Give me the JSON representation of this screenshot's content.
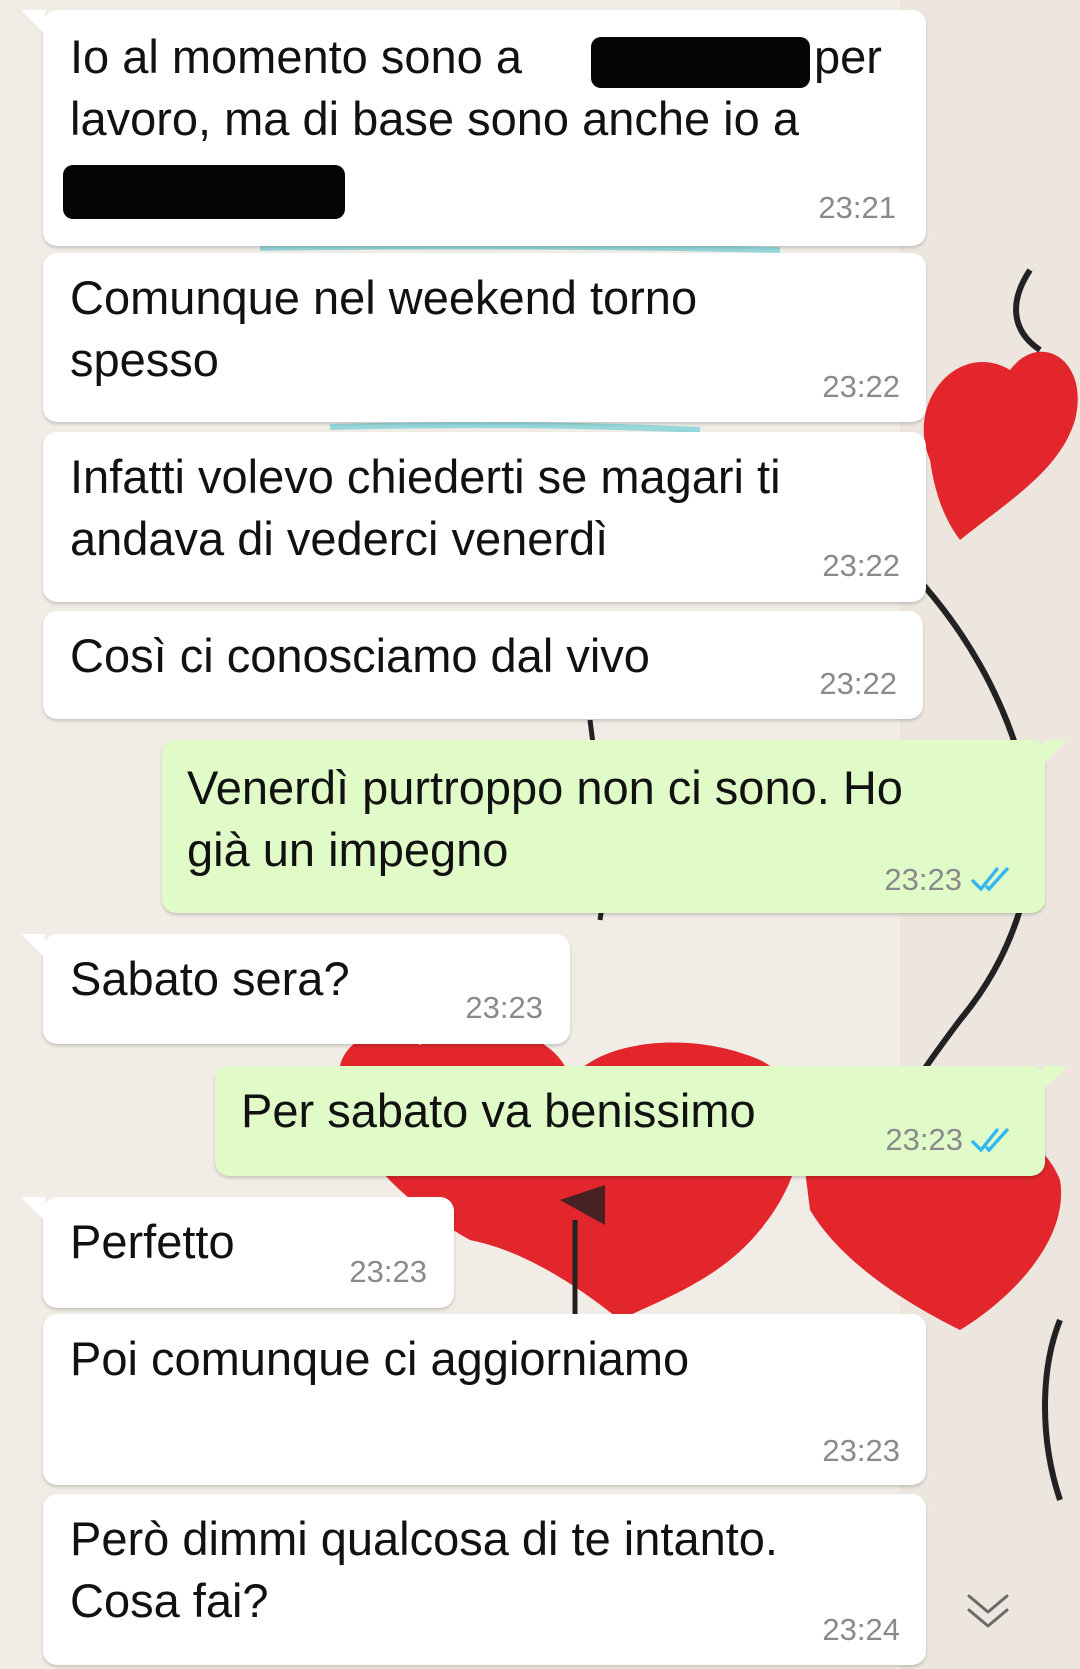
{
  "messages": [
    {
      "dir": "in",
      "lines": [
        "Io al momento sono a",
        "lavoro, ma di base sono anche io a"
      ],
      "line1_tail": "per",
      "time": "23:21"
    },
    {
      "dir": "in",
      "text": "Comunque nel weekend torno\nspesso",
      "time": "23:22"
    },
    {
      "dir": "in",
      "text": "Infatti volevo chiederti se magari ti\nandava di vederci venerdì",
      "time": "23:22"
    },
    {
      "dir": "in",
      "text": "Così ci conosciamo dal vivo",
      "time": "23:22"
    },
    {
      "dir": "out",
      "text": "Venerdì purtroppo non ci sono. Ho\ngià un impegno",
      "time": "23:23",
      "status": "read"
    },
    {
      "dir": "in",
      "text": "Sabato sera?",
      "time": "23:23"
    },
    {
      "dir": "out",
      "text": "Per sabato va benissimo",
      "time": "23:23",
      "status": "read"
    },
    {
      "dir": "in",
      "text": "Perfetto",
      "time": "23:23"
    },
    {
      "dir": "in",
      "text": "Poi comunque ci aggiorniamo",
      "time": "23:23"
    },
    {
      "dir": "in",
      "text": "Però dimmi qualcosa di te intanto.\nCosa fai?",
      "time": "23:24"
    }
  ],
  "colors": {
    "incoming_bubble": "#ffffff",
    "outgoing_bubble": "#e1fbc8",
    "timestamp": "#8a8a8a",
    "read_ticks": "#34b7f1",
    "wallpaper_heart": "#e2262b"
  },
  "icons": {
    "read_receipt": "double-check-icon",
    "scroll_down": "double-chevron-down-icon"
  }
}
